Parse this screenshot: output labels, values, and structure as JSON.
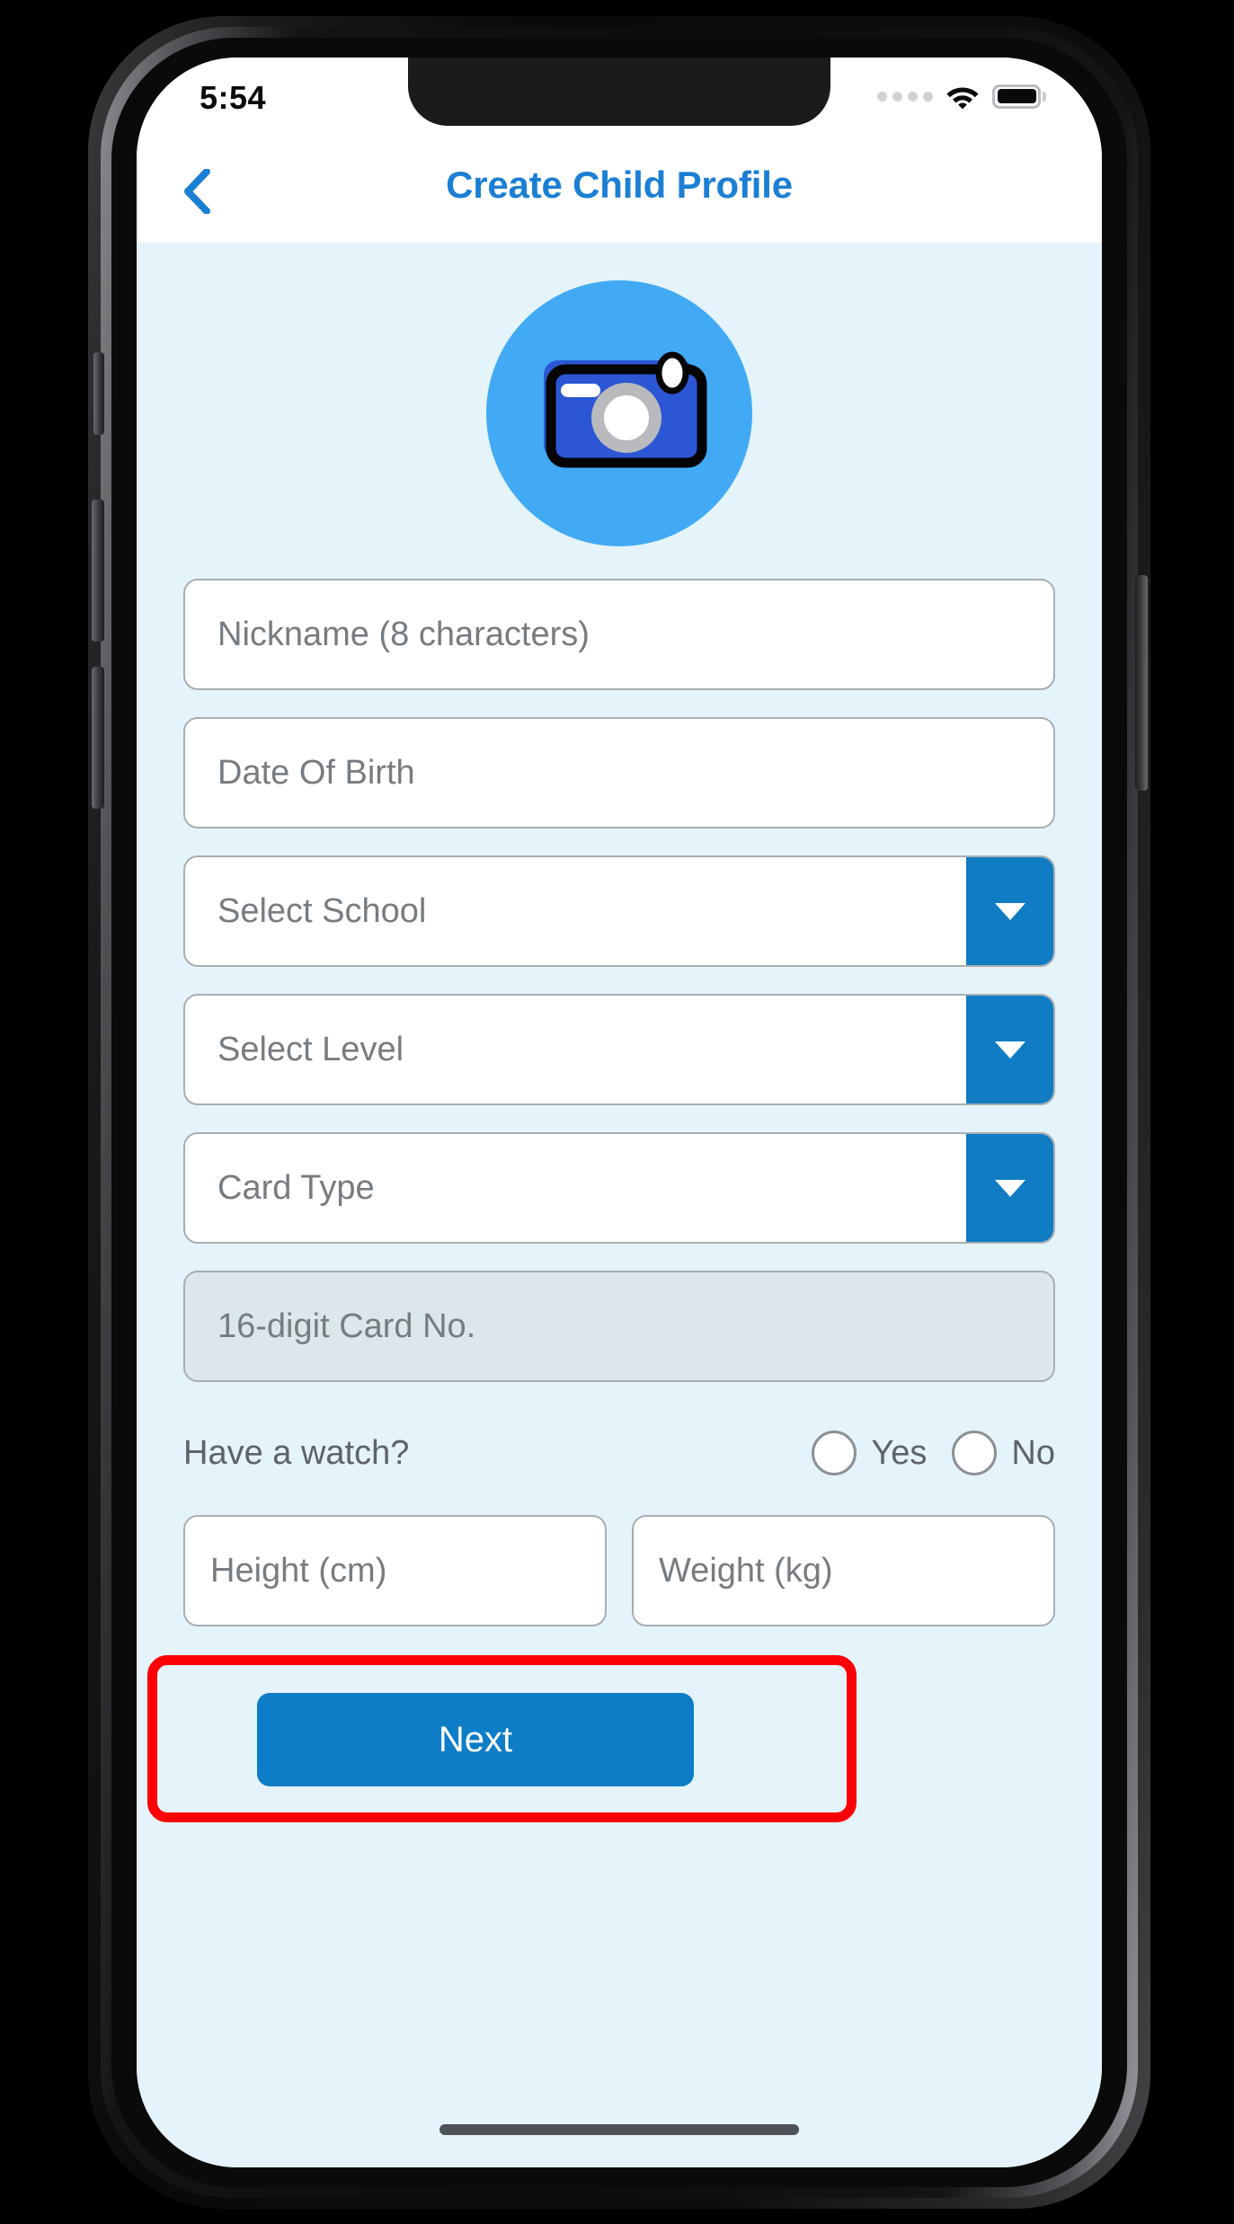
{
  "status_bar": {
    "time": "5:54",
    "signal_icon": "signal-dots-icon",
    "wifi_icon": "wifi-icon",
    "battery_icon": "battery-full-icon"
  },
  "nav": {
    "back_icon": "chevron-left-icon",
    "title": "Create Child Profile"
  },
  "avatar": {
    "icon": "camera-icon",
    "circle_color": "#42aaf5",
    "camera_body_color": "#2b56d4"
  },
  "form": {
    "fields": [
      {
        "name": "nickname",
        "placeholder": "Nickname (8 characters)",
        "value": "",
        "type": "text",
        "disabled": false
      },
      {
        "name": "date-of-birth",
        "placeholder": "Date Of Birth",
        "value": "",
        "type": "text",
        "disabled": false
      },
      {
        "name": "select-school",
        "placeholder": "Select School",
        "value": "",
        "type": "select",
        "disabled": false
      },
      {
        "name": "select-level",
        "placeholder": "Select Level",
        "value": "",
        "type": "select",
        "disabled": false
      },
      {
        "name": "card-type",
        "placeholder": "Card Type",
        "value": "",
        "type": "select",
        "disabled": false
      },
      {
        "name": "card-number",
        "placeholder": "16-digit Card No.",
        "value": "",
        "type": "text",
        "disabled": true
      }
    ],
    "watch_question": {
      "label": "Have a watch?",
      "options": [
        {
          "label": "Yes",
          "selected": false
        },
        {
          "label": "No",
          "selected": false
        }
      ]
    },
    "measurements": [
      {
        "name": "height",
        "placeholder": "Height (cm)",
        "value": ""
      },
      {
        "name": "weight",
        "placeholder": "Weight (kg)",
        "value": ""
      }
    ]
  },
  "actions": {
    "next_label": "Next",
    "next_color": "#0d7dc7",
    "highlight_color": "#fb0006"
  },
  "colors": {
    "screen_background": "#e5f3fb",
    "header_background": "#ffffff",
    "accent_blue": "#1b7fd4",
    "dropdown_blue": "#0f7cc4",
    "placeholder_grey": "#767c81",
    "field_border": "#a9aeb2",
    "disabled_field": "#dce7ec"
  }
}
